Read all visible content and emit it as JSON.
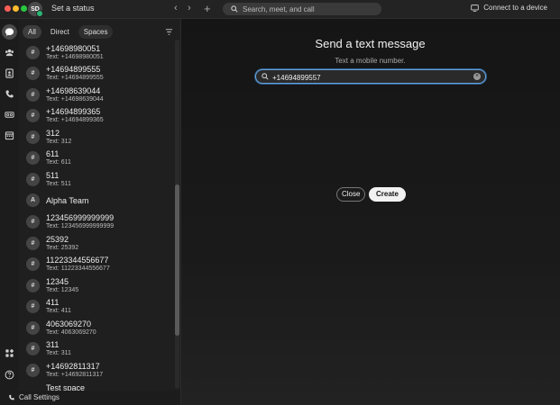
{
  "topbar": {
    "avatar_initials": "SD",
    "set_status": "Set a status",
    "search_placeholder": "Search, meet, and call",
    "connect_device": "Connect to a device"
  },
  "filters": {
    "all": "All",
    "direct": "Direct",
    "spaces": "Spaces"
  },
  "spaces": [
    {
      "avatar": "#",
      "title": "+14698980051",
      "sub": "Text: +14698980051"
    },
    {
      "avatar": "#",
      "title": "+14694899555",
      "sub": "Text: +14694899555"
    },
    {
      "avatar": "#",
      "title": "+14698639044",
      "sub": "Text: +14698639044"
    },
    {
      "avatar": "#",
      "title": "+14694899365",
      "sub": "Text: +14694899365"
    },
    {
      "avatar": "#",
      "title": "312",
      "sub": "Text: 312"
    },
    {
      "avatar": "#",
      "title": "611",
      "sub": "Text: 611"
    },
    {
      "avatar": "#",
      "title": "511",
      "sub": "Text: 511"
    },
    {
      "avatar": "A",
      "title": "Alpha Team",
      "sub": ""
    },
    {
      "avatar": "#",
      "title": "123456999999999",
      "sub": "Text: 123456999999999"
    },
    {
      "avatar": "#",
      "title": "25392",
      "sub": "Text: 25392"
    },
    {
      "avatar": "#",
      "title": "11223344556677",
      "sub": "Text: 11223344556677"
    },
    {
      "avatar": "#",
      "title": "12345",
      "sub": "Text: 12345"
    },
    {
      "avatar": "#",
      "title": "411",
      "sub": "Text: 411"
    },
    {
      "avatar": "#",
      "title": "4063069270",
      "sub": "Text: 4063069270"
    },
    {
      "avatar": "#",
      "title": "311",
      "sub": "Text: 311"
    },
    {
      "avatar": "#",
      "title": "+14692811317",
      "sub": "Text: +14692811317"
    },
    {
      "avatar": "#",
      "title": "Test space",
      "sub": ""
    }
  ],
  "call_settings": "Call Settings",
  "dialog": {
    "title": "Send a text message",
    "subtitle": "Text a mobile number.",
    "phone_value": "+14694899557",
    "close_label": "Close",
    "create_label": "Create"
  },
  "icons": {
    "rail": [
      "messaging-icon",
      "teams-icon",
      "contacts-icon",
      "calling-icon",
      "voicemail-icon",
      "calendar-icon",
      "apps-icon",
      "help-icon"
    ]
  },
  "colors": {
    "accent_focus": "#6aa0d9",
    "presence": "#2bb673"
  }
}
